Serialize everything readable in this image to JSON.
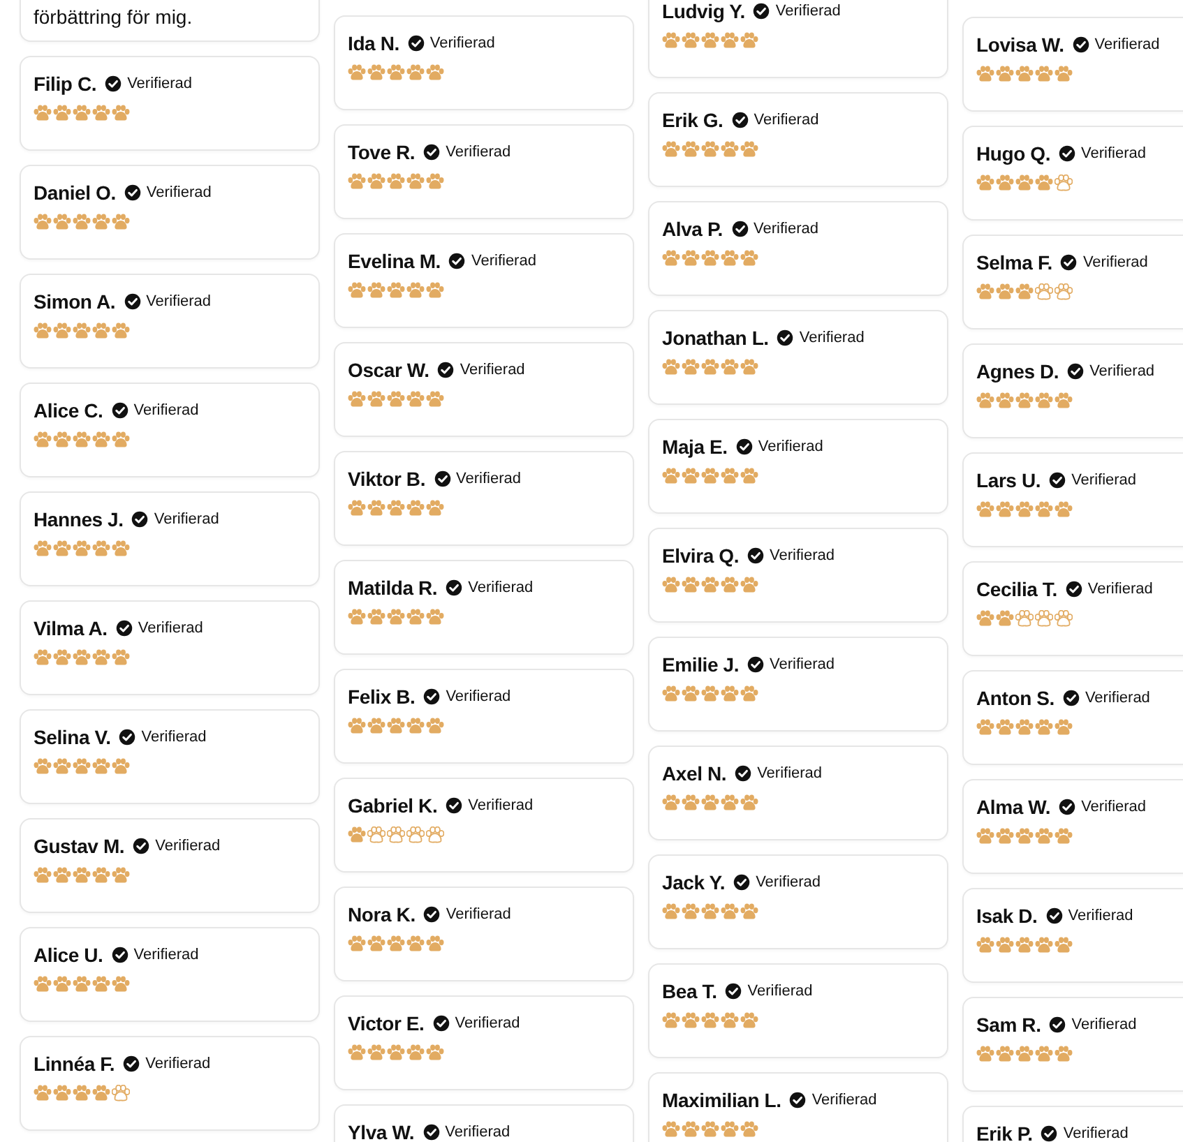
{
  "columns": [
    {
      "cards": [
        {
          "kind": "text",
          "text": "förbättring för mig."
        },
        {
          "kind": "review",
          "name": "Filip C.",
          "badge": "Verifierad",
          "stars": 5
        },
        {
          "kind": "review",
          "name": "Daniel O.",
          "badge": "Verifierad",
          "stars": 5
        },
        {
          "kind": "review",
          "name": "Simon A.",
          "badge": "Verifierad",
          "stars": 5
        },
        {
          "kind": "review",
          "name": "Alice C.",
          "badge": "Verifierad",
          "stars": 5
        },
        {
          "kind": "review",
          "name": "Hannes J.",
          "badge": "Verifierad",
          "stars": 5
        },
        {
          "kind": "review",
          "name": "Vilma A.",
          "badge": "Verifierad",
          "stars": 5
        },
        {
          "kind": "review",
          "name": "Selina V.",
          "badge": "Verifierad",
          "stars": 5
        },
        {
          "kind": "review",
          "name": "Gustav M.",
          "badge": "Verifierad",
          "stars": 5
        },
        {
          "kind": "review",
          "name": "Alice U.",
          "badge": "Verifierad",
          "stars": 5
        },
        {
          "kind": "review",
          "name": "Linnéa F.",
          "badge": "Verifierad",
          "stars": 4
        }
      ]
    },
    {
      "cards": [
        {
          "kind": "review",
          "name": "Ida N.",
          "badge": "Verifierad",
          "stars": 5
        },
        {
          "kind": "review",
          "name": "Tove R.",
          "badge": "Verifierad",
          "stars": 5
        },
        {
          "kind": "review",
          "name": "Evelina M.",
          "badge": "Verifierad",
          "stars": 5
        },
        {
          "kind": "review",
          "name": "Oscar W.",
          "badge": "Verifierad",
          "stars": 5
        },
        {
          "kind": "review",
          "name": "Viktor B.",
          "badge": "Verifierad",
          "stars": 5
        },
        {
          "kind": "review",
          "name": "Matilda R.",
          "badge": "Verifierad",
          "stars": 5
        },
        {
          "kind": "review",
          "name": "Felix B.",
          "badge": "Verifierad",
          "stars": 5
        },
        {
          "kind": "review",
          "name": "Gabriel K.",
          "badge": "Verifierad",
          "stars": 1
        },
        {
          "kind": "review",
          "name": "Nora K.",
          "badge": "Verifierad",
          "stars": 5
        },
        {
          "kind": "review",
          "name": "Victor E.",
          "badge": "Verifierad",
          "stars": 5
        },
        {
          "kind": "review",
          "name": "Ylva W.",
          "badge": "Verifierad"
        }
      ]
    },
    {
      "cards": [
        {
          "kind": "review",
          "name": "Ludvig Y.",
          "badge": "Verifierad",
          "stars": 5
        },
        {
          "kind": "review",
          "name": "Erik G.",
          "badge": "Verifierad",
          "stars": 5
        },
        {
          "kind": "review",
          "name": "Alva P.",
          "badge": "Verifierad",
          "stars": 5
        },
        {
          "kind": "review",
          "name": "Jonathan L.",
          "badge": "Verifierad",
          "stars": 5
        },
        {
          "kind": "review",
          "name": "Maja E.",
          "badge": "Verifierad",
          "stars": 5
        },
        {
          "kind": "review",
          "name": "Elvira Q.",
          "badge": "Verifierad",
          "stars": 5
        },
        {
          "kind": "review",
          "name": "Emilie J.",
          "badge": "Verifierad",
          "stars": 5
        },
        {
          "kind": "review",
          "name": "Axel N.",
          "badge": "Verifierad",
          "stars": 5
        },
        {
          "kind": "review",
          "name": "Jack Y.",
          "badge": "Verifierad",
          "stars": 5
        },
        {
          "kind": "review",
          "name": "Bea T.",
          "badge": "Verifierad",
          "stars": 5
        },
        {
          "kind": "review",
          "name": "Maximilian L.",
          "badge": "Verifierad",
          "stars": 5
        }
      ]
    },
    {
      "cards": [
        {
          "kind": "review",
          "name": "Lovisa W.",
          "badge": "Verifierad",
          "stars": 5
        },
        {
          "kind": "review",
          "name": "Hugo Q.",
          "badge": "Verifierad",
          "stars": 4
        },
        {
          "kind": "review",
          "name": "Selma F.",
          "badge": "Verifierad",
          "stars": 3
        },
        {
          "kind": "review",
          "name": "Agnes D.",
          "badge": "Verifierad",
          "stars": 5
        },
        {
          "kind": "review",
          "name": "Lars U.",
          "badge": "Verifierad",
          "stars": 5
        },
        {
          "kind": "review",
          "name": "Cecilia T.",
          "badge": "Verifierad",
          "stars": 2
        },
        {
          "kind": "review",
          "name": "Anton S.",
          "badge": "Verifierad",
          "stars": 5
        },
        {
          "kind": "review",
          "name": "Alma W.",
          "badge": "Verifierad",
          "stars": 5
        },
        {
          "kind": "review",
          "name": "Isak D.",
          "badge": "Verifierad",
          "stars": 5
        },
        {
          "kind": "review",
          "name": "Sam R.",
          "badge": "Verifierad",
          "stars": 5
        },
        {
          "kind": "review",
          "name": "Erik P.",
          "badge": "Verifierad"
        }
      ]
    }
  ]
}
